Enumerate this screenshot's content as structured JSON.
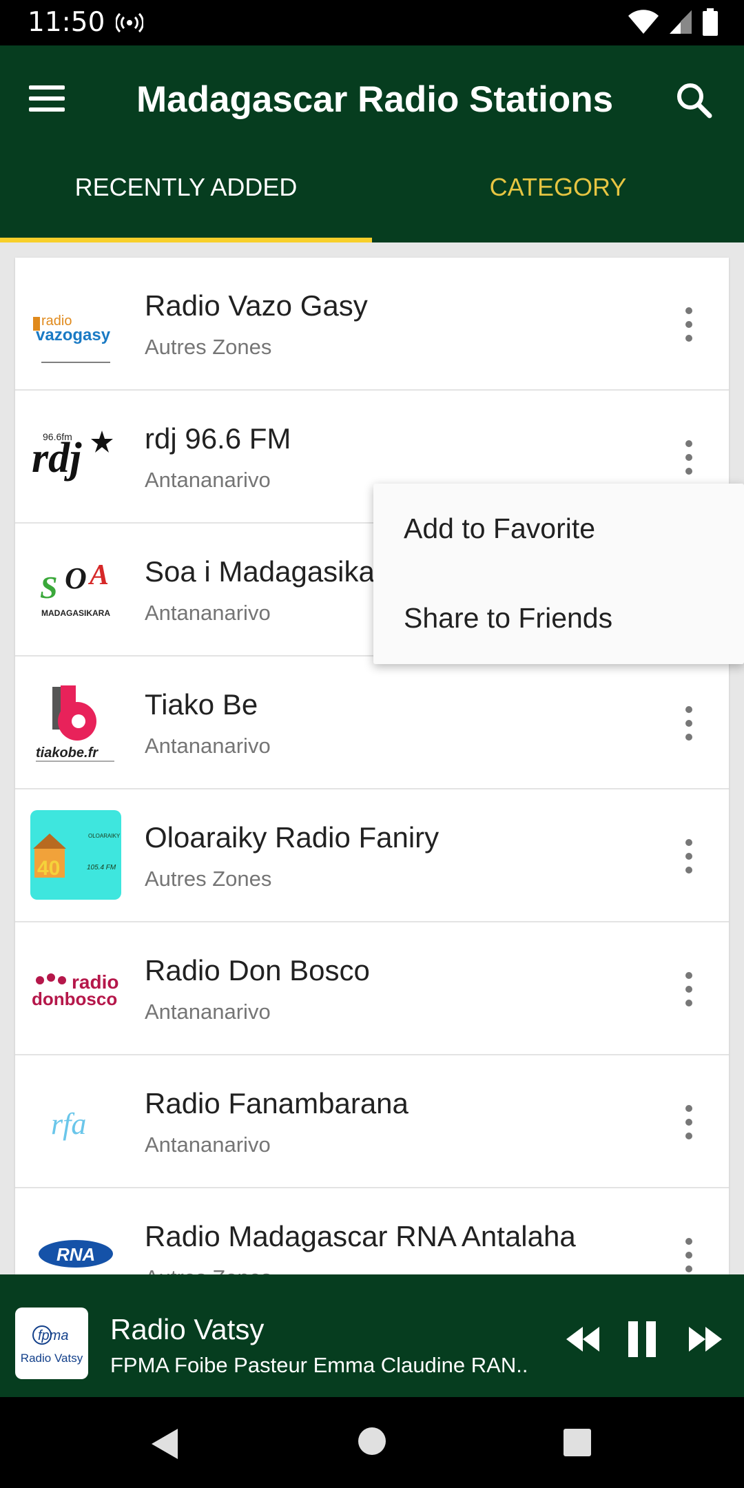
{
  "status_bar": {
    "time": "11:50"
  },
  "app_bar": {
    "title": "Madagascar Radio Stations"
  },
  "tabs": [
    {
      "label": "RECENTLY ADDED"
    },
    {
      "label": "CATEGORY"
    }
  ],
  "stations": [
    {
      "name": "Radio Vazo Gasy",
      "region": "Autres Zones",
      "logo_text": "radio vazogasy"
    },
    {
      "name": "rdj 96.6 FM",
      "region": "Antananarivo",
      "logo_text": "rdj",
      "logo_small": "96.6fm"
    },
    {
      "name": "Soa i Madagasikara",
      "region": "Antananarivo",
      "logo_text": "SOA",
      "logo_small": "MADAGASIKARA"
    },
    {
      "name": "Tiako Be",
      "region": "Antananarivo",
      "logo_text": "tiakobe.fr"
    },
    {
      "name": "Oloaraiky Radio Faniry",
      "region": "Autres Zones",
      "logo_text": "OLOARAIKY",
      "logo_small": "105.4 FM"
    },
    {
      "name": "Radio Don Bosco",
      "region": "Antananarivo",
      "logo_text": "radio",
      "logo_small": "donbosco"
    },
    {
      "name": "Radio Fanambarana",
      "region": "Antananarivo",
      "logo_text": "rfa"
    },
    {
      "name": "Radio Madagascar RNA Antalaha",
      "region": "Autres Zones",
      "logo_text": "RNA"
    }
  ],
  "popup_menu": {
    "items": [
      "Add to Favorite",
      "Share to Friends"
    ]
  },
  "player": {
    "title": "Radio Vatsy",
    "subtitle": "FPMA Foibe Pasteur Emma Claudine RAN..",
    "logo_text": "Radio Vatsy",
    "logo_mark": "fpma"
  },
  "colors": {
    "primary": "#063d1f",
    "accent": "#f7cf2a",
    "inactive_tab": "#e6c542"
  }
}
